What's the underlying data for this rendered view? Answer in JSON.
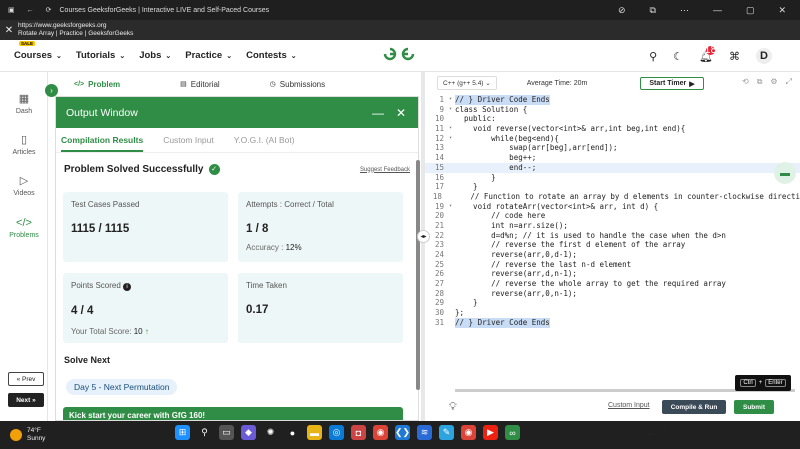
{
  "browser": {
    "tab_title": "Courses GeeksforGeeks | Interactive LIVE and Self-Paced Courses",
    "url": "https://www.geeksforgeeks.org",
    "page_title": "Rotate Array | Practice | GeeksforGeeks"
  },
  "nav": {
    "sale_badge": "SALE",
    "items": [
      "Courses",
      "Tutorials",
      "Jobs",
      "Practice",
      "Contests"
    ],
    "logo": "GfG",
    "notification_count": "18",
    "avatar_letter": "D"
  },
  "sidebar": {
    "items": [
      "Dash",
      "Articles",
      "Videos",
      "Problems"
    ],
    "prev": "« Prev",
    "next": "Next »"
  },
  "left_tabs": [
    "Problem",
    "Editorial",
    "Submissions"
  ],
  "output": {
    "title": "Output Window",
    "tabs": [
      "Compilation Results",
      "Custom Input",
      "Y.O.G.I. (AI Bot)"
    ],
    "status": "Problem Solved Successfully",
    "feedback": "Suggest Feedback",
    "test_cases_label": "Test Cases Passed",
    "test_cases_value": "1115 / 1115",
    "attempts_label": "Attempts : Correct / Total",
    "attempts_value": "1 / 8",
    "accuracy_label": "Accuracy :",
    "accuracy_value": "12%",
    "points_label": "Points Scored",
    "points_value": "4 / 4",
    "total_score_label": "Your Total Score:",
    "total_score_value": "10",
    "time_label": "Time Taken",
    "time_value": "0.17",
    "solve_next": "Solve Next",
    "next_problem": "Day 5 - Next Permutation",
    "banner": "Kick start your career with GfG 160!"
  },
  "editor": {
    "language": "C++ (g++ 5.4)",
    "avg_time": "Average Time: 20m",
    "timer": "Start Timer",
    "lines": [
      {
        "n": "1",
        "t": "// } Driver Code Ends",
        "fold": true,
        "cls": "sel"
      },
      {
        "n": "9",
        "t": "class Solution {",
        "fold": true
      },
      {
        "n": "10",
        "t": "  public:"
      },
      {
        "n": "11",
        "t": "    void reverse(vector<int>& arr,int beg,int end){",
        "fold": true
      },
      {
        "n": "12",
        "t": "        while(beg<end){",
        "fold": true
      },
      {
        "n": "13",
        "t": "            swap(arr[beg],arr[end]);"
      },
      {
        "n": "14",
        "t": "            beg++;"
      },
      {
        "n": "15",
        "t": "            end--;",
        "cls": "hl"
      },
      {
        "n": "16",
        "t": "        }"
      },
      {
        "n": "17",
        "t": "    }"
      },
      {
        "n": "18",
        "t": "    // Function to rotate an array by d elements in counter-clockwise directi"
      },
      {
        "n": "19",
        "t": "    void rotateArr(vector<int>& arr, int d) {",
        "fold": true
      },
      {
        "n": "20",
        "t": "        // code here"
      },
      {
        "n": "21",
        "t": "        int n=arr.size();"
      },
      {
        "n": "22",
        "t": "        d=d%n; // it is used to handle the case when the d>n"
      },
      {
        "n": "23",
        "t": "        // reverse the first d element of the array"
      },
      {
        "n": "24",
        "t": "        reverse(arr,0,d-1);"
      },
      {
        "n": "25",
        "t": "        // reverse the last n-d element"
      },
      {
        "n": "26",
        "t": "        reverse(arr,d,n-1);"
      },
      {
        "n": "27",
        "t": "        // reverse the whole array to get the required array"
      },
      {
        "n": "28",
        "t": "        reverse(arr,0,n-1);"
      },
      {
        "n": "29",
        "t": "    }"
      },
      {
        "n": "30",
        "t": "};"
      },
      {
        "n": "31",
        "t": "// } Driver Code Ends",
        "cls": "sel"
      }
    ],
    "custom_input": "Custom Input",
    "compile_run": "Compile & Run",
    "submit": "Submit",
    "tooltip_key1": "Ctrl",
    "tooltip_plus": "+",
    "tooltip_key2": "Enter"
  },
  "taskbar": {
    "temp": "74°F",
    "weather": "Sunny",
    "lang1": "ENG",
    "lang2": "IN",
    "time": "12:40",
    "date": "27 November"
  }
}
